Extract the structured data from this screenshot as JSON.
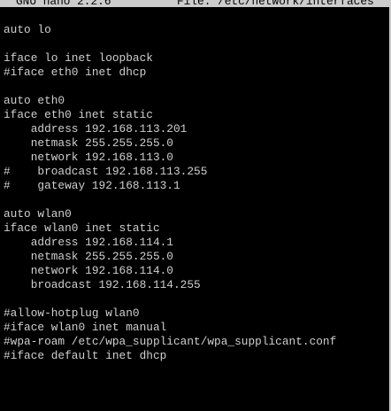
{
  "title_bar": {
    "app_name": "GNU nano 2.2.6",
    "file_label": "File: /etc/network/interfaces"
  },
  "editor": {
    "lines": [
      "auto lo",
      "",
      "iface lo inet loopback",
      "#iface eth0 inet dhcp",
      "",
      "auto eth0",
      "iface eth0 inet static",
      "    address 192.168.113.201",
      "    netmask 255.255.255.0",
      "    network 192.168.113.0",
      "#    broadcast 192.168.113.255",
      "#    gateway 192.168.113.1",
      "",
      "auto wlan0",
      "iface wlan0 inet static",
      "    address 192.168.114.1",
      "    netmask 255.255.255.0",
      "    network 192.168.114.0",
      "    broadcast 192.168.114.255",
      "",
      "#allow-hotplug wlan0",
      "#iface wlan0 inet manual",
      "#wpa-roam /etc/wpa_supplicant/wpa_supplicant.conf",
      "#iface default inet dhcp"
    ]
  },
  "colors": {
    "background": "#000000",
    "text": "#cfcfcf",
    "title_bar_bg": "#cccccc",
    "title_bar_text": "#000000"
  }
}
